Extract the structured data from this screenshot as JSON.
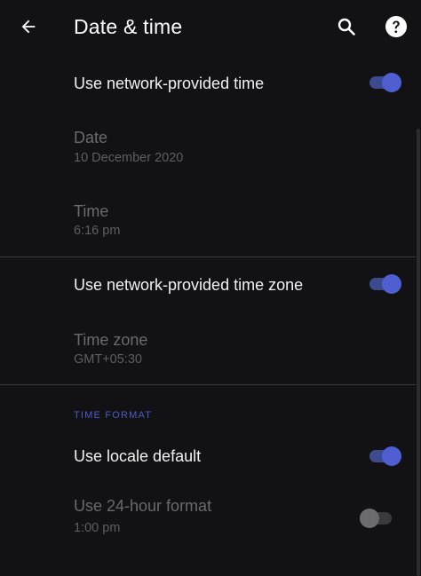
{
  "appbar": {
    "title": "Date & time",
    "back_icon": "arrow-left-icon",
    "search_icon": "search-icon",
    "help_icon": "help-icon"
  },
  "settings": {
    "network_time": {
      "title": "Use network-provided time",
      "enabled": true
    },
    "date": {
      "title": "Date",
      "value": "10 December 2020"
    },
    "time": {
      "title": "Time",
      "value": "6:16 pm"
    },
    "network_timezone": {
      "title": "Use network-provided time zone",
      "enabled": true
    },
    "time_zone": {
      "title": "Time zone",
      "value": "GMT+05:30"
    },
    "time_format_header": "TIME FORMAT",
    "locale_default": {
      "title": "Use locale default",
      "enabled": true
    },
    "hour24": {
      "title": "Use 24-hour format",
      "value": "1:00 pm",
      "enabled": false
    }
  },
  "colors": {
    "background": "#121214",
    "accent": "#4f5ed0",
    "section_header": "#4b5bc7"
  }
}
